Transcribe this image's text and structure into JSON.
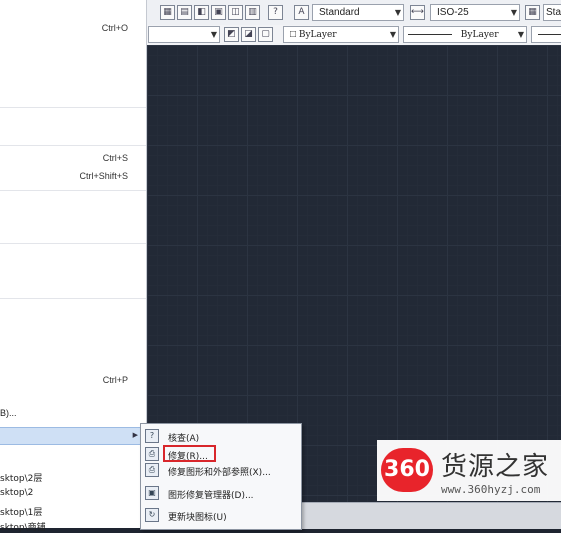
{
  "toolbar": {
    "text_style": "Standard",
    "dim_style": "ISO-25",
    "table_style_partial": "Sta",
    "layer_color": "ByLayer",
    "layer_linetype": "ByLayer",
    "color_prefix": "□"
  },
  "app_menu": {
    "shortcuts": {
      "open": "Ctrl+O",
      "save": "Ctrl+S",
      "save_as": "Ctrl+Shift+S",
      "print": "Ctrl+P"
    },
    "truncated_item": "B)...",
    "recent_files": [
      "sktop\\2层",
      "sktop\\2",
      "sktop\\1层",
      "sktop\\商铺"
    ]
  },
  "submenu": {
    "items": [
      {
        "label": "核查(A)",
        "icon": "audit-icon"
      },
      {
        "label": "修复(R)...",
        "icon": "recover-icon"
      },
      {
        "label": "修复图形和外部参照(X)...",
        "icon": "recover-xref-icon"
      },
      {
        "label": "图形修复管理器(D)...",
        "icon": "recovery-manager-icon"
      },
      {
        "label": "更新块图标(U)",
        "icon": "update-block-icon"
      }
    ]
  },
  "watermark": {
    "logo": "360",
    "name": "货源之家",
    "url": "www.360hyzj.com"
  }
}
